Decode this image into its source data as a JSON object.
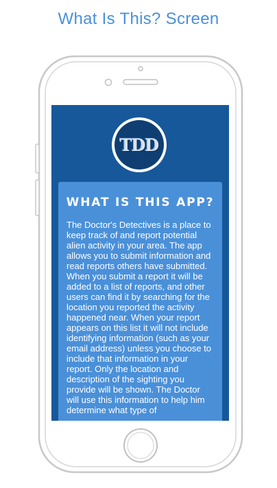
{
  "caption": "What Is This? Screen",
  "app": {
    "logo_text": "TDD",
    "card_title": "WHAT IS THIS APP?",
    "card_body": "The Doctor's Detectives is a place to keep track of and report potential alien activity in your area. The app allows you to submit information and read reports others have submitted. When you submit a report it will be added to a list of reports, and other users can find it by searching for the location you reported the activity happened near. When your report appears on this list it will not include identifying information (such as your email address) unless you choose to include that information in your report. Only the location and description of the sighting you provide will be shown. The Doctor will use this information to help him determine what type of"
  },
  "colors": {
    "caption": "#4a90d9",
    "screen_background": "#17589b",
    "card_background": "#4a90d9",
    "logo_circle": "#0f3f72",
    "phone_outline": "#c8c8c8"
  }
}
